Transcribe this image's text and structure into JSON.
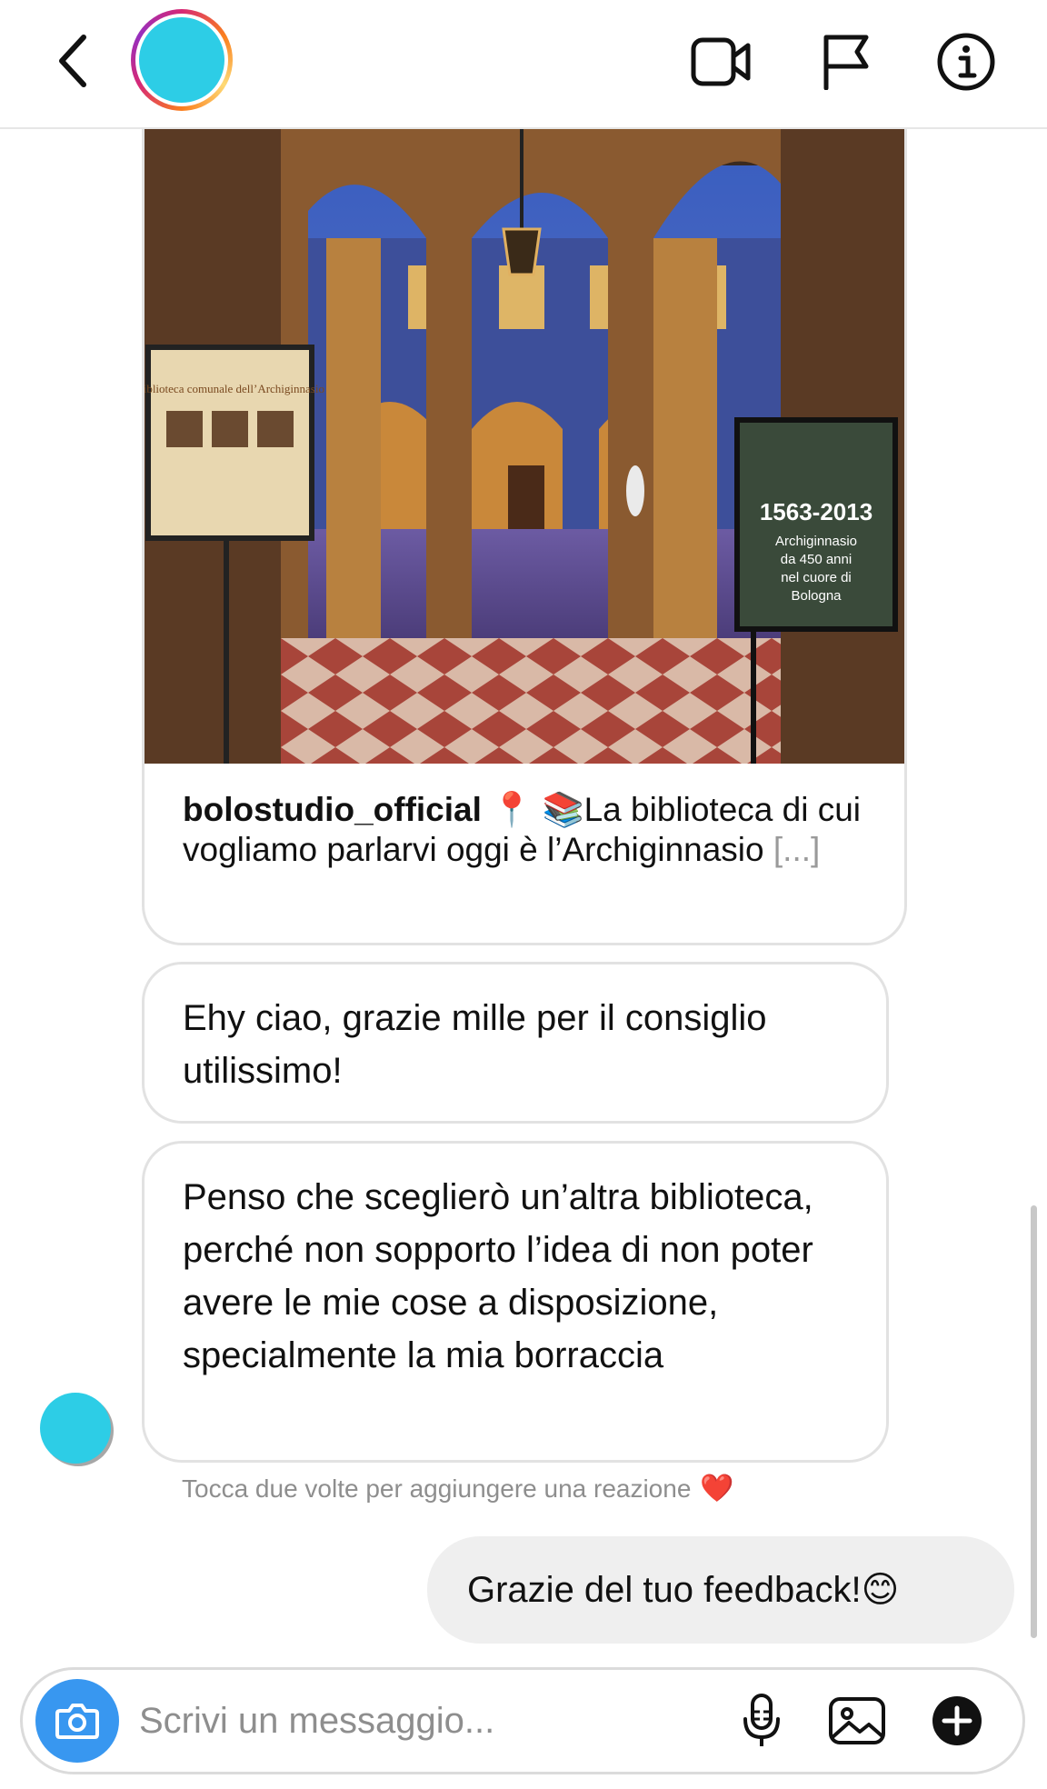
{
  "header": {
    "back_icon": "chevron-left-icon",
    "avatar_color": "#2dcde6",
    "video_icon": "video-call-icon",
    "flag_icon": "flag-icon",
    "info_icon": "info-icon"
  },
  "post": {
    "username": "bolostudio_official",
    "caption": " 📍 📚La biblioteca di cui vogliamo parlarvi oggi è l’Archiginnasio ",
    "more": "[...]",
    "image_signs": {
      "left_sign_title": "Biblioteca comunale dell’Archiginnasio",
      "right_sign_years": "1563-2013",
      "right_sign_text": [
        "Archiginnasio",
        "da 450 anni",
        "nel cuore di",
        "Bologna"
      ]
    }
  },
  "messages": {
    "incoming": [
      "Ehy ciao, grazie mille per il consiglio utilissimo!",
      "Penso che sceglierò un’altra biblioteca, perché non sopporto l’idea di non poter avere le mie cose a disposizione, specialmente la mia borraccia"
    ],
    "reaction_hint": "Tocca due volte per aggiungere una reazione",
    "reaction_emoji": "❤️",
    "outgoing": "Grazie del tuo feedback!😊"
  },
  "composer": {
    "placeholder": "Scrivi un messaggio...",
    "camera_icon": "camera-icon",
    "mic_icon": "microphone-icon",
    "gallery_icon": "gallery-icon",
    "plus_icon": "plus-icon",
    "accent": "#3897f0"
  }
}
